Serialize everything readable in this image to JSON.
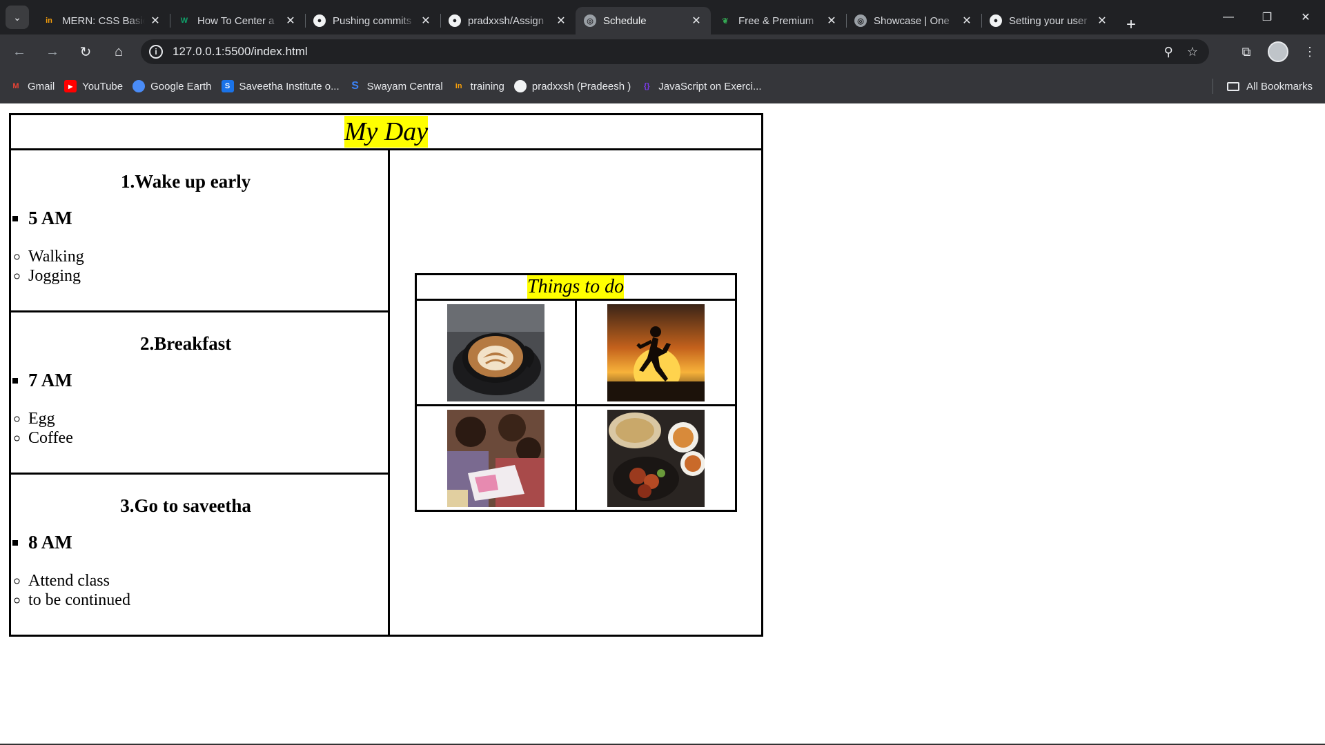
{
  "browser": {
    "tabs": [
      {
        "title": "MERN: CSS Basic",
        "icon": "mern-icon",
        "active": false
      },
      {
        "title": "How To Center a",
        "icon": "w-icon",
        "active": false
      },
      {
        "title": "Pushing commits",
        "icon": "github-icon",
        "active": false
      },
      {
        "title": "pradxxsh/Assign",
        "icon": "github-icon",
        "active": false
      },
      {
        "title": "Schedule",
        "icon": "globe-icon",
        "active": true
      },
      {
        "title": "Free & Premium",
        "icon": "leaf-icon",
        "active": false
      },
      {
        "title": "Showcase | One",
        "icon": "globe-icon",
        "active": false
      },
      {
        "title": "Setting your user",
        "icon": "github-icon",
        "active": false
      }
    ],
    "address": "127.0.0.1:5500/index.html",
    "bookmarks": [
      {
        "label": "Gmail",
        "icon": "gmail-icon"
      },
      {
        "label": "YouTube",
        "icon": "youtube-icon"
      },
      {
        "label": "Google Earth",
        "icon": "earth-icon"
      },
      {
        "label": "Saveetha Institute o...",
        "icon": "saveetha-icon"
      },
      {
        "label": "Swayam Central",
        "icon": "swayam-icon"
      },
      {
        "label": "training",
        "icon": "mern-icon"
      },
      {
        "label": "pradxxsh (Pradeesh )",
        "icon": "github-icon"
      },
      {
        "label": "JavaScript on Exerci...",
        "icon": "exercism-icon"
      }
    ],
    "all_bookmarks": "All Bookmarks"
  },
  "page": {
    "title": "My Day",
    "sections": [
      {
        "heading": "1.Wake up early",
        "time": "5 AM",
        "items": [
          "Walking",
          "Jogging"
        ]
      },
      {
        "heading": "2.Breakfast",
        "time": "7 AM",
        "items": [
          "Egg",
          "Coffee"
        ]
      },
      {
        "heading": "3.Go to saveetha",
        "time": "8 AM",
        "items": [
          "Attend class",
          "to be continued"
        ]
      }
    ],
    "todo": {
      "title": "Things to do",
      "images": [
        "coffee-latte-photo",
        "runner-sunset-photo",
        "kids-reading-photo",
        "food-platter-photo"
      ]
    }
  },
  "colors": {
    "highlight": "#ffff00",
    "chrome_dark": "#202124",
    "chrome_toolbar": "#35363a"
  }
}
